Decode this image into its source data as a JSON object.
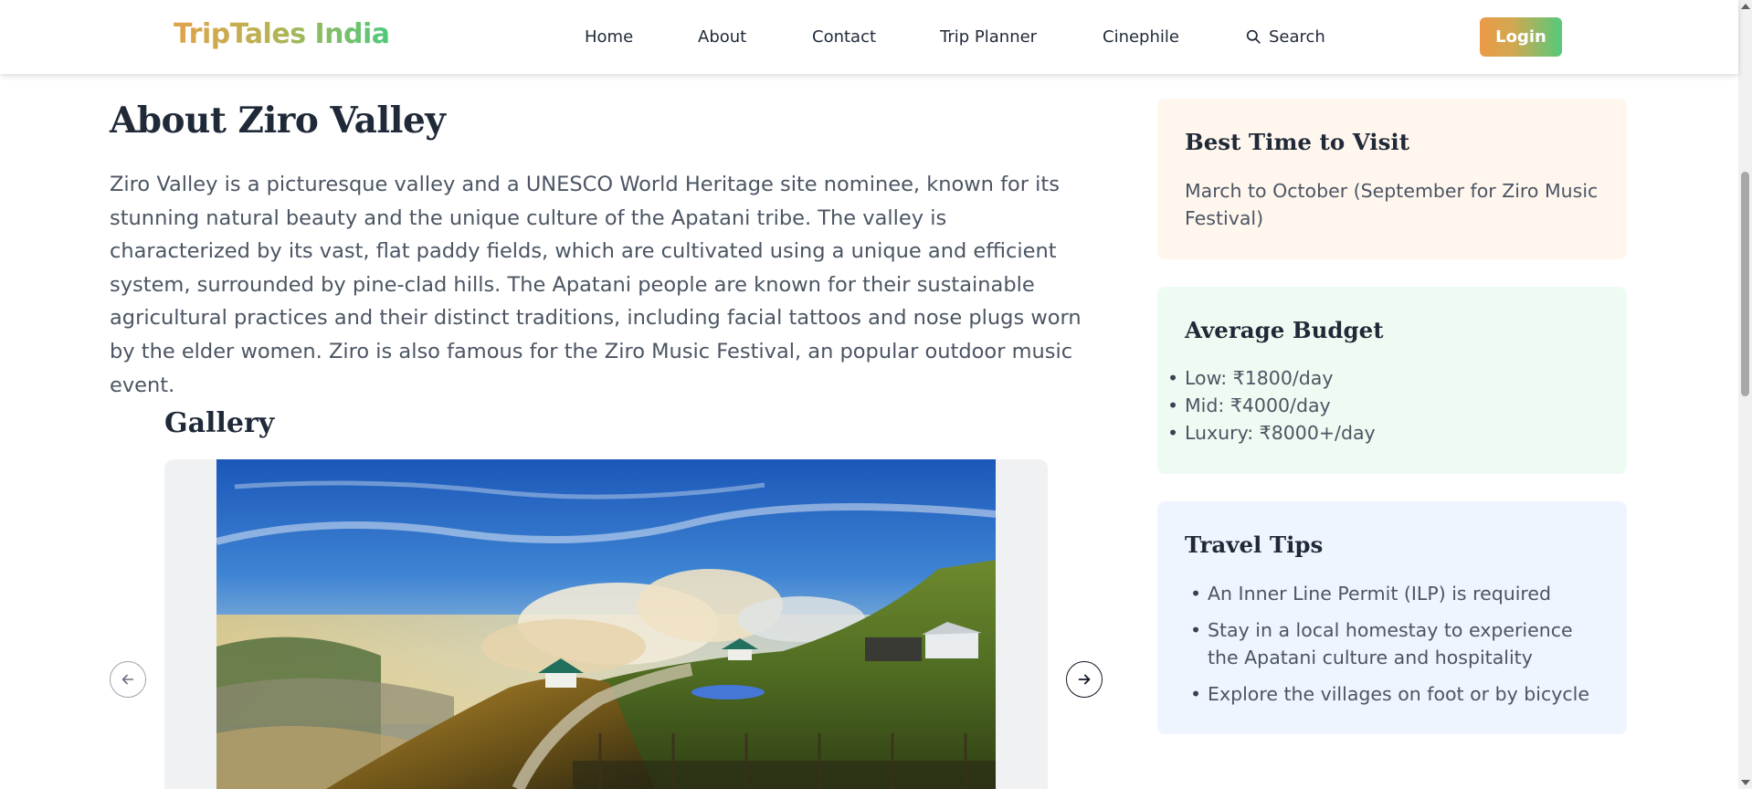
{
  "header": {
    "logo": "TripTales India",
    "nav": [
      {
        "label": "Home"
      },
      {
        "label": "About"
      },
      {
        "label": "Contact"
      },
      {
        "label": "Trip Planner"
      },
      {
        "label": "Cinephile"
      }
    ],
    "search": {
      "label": "Search",
      "icon": "search-icon"
    },
    "login_label": "Login",
    "login_colors": [
      "#ec9a45",
      "#55c97a"
    ]
  },
  "main": {
    "title": "About Ziro Valley",
    "intro": "Ziro Valley is a picturesque valley and a UNESCO World Heritage site nominee, known for its stunning natural beauty and the unique culture of the Apatani tribe. The valley is characterized by its vast, flat paddy fields, which are cultivated using a unique and efficient system, surrounded by pine-clad hills. The Apatani people are known for their sustainable agricultural practices and their distinct traditions, including facial tattoos and nose plugs worn by the elder women. Ziro is also famous for the Ziro Music Festival, an popular outdoor music event.",
    "gallery": {
      "title": "Gallery",
      "prev_icon": "arrow-left-icon",
      "next_icon": "arrow-right-icon"
    }
  },
  "sidebar": {
    "best_time": {
      "title": "Best Time to Visit",
      "text": "March to October (September for Ziro Music Festival)",
      "bg": "#fff6ee"
    },
    "budget": {
      "title": "Average Budget",
      "items": [
        "Low: ₹1800/day",
        "Mid: ₹4000/day",
        "Luxury: ₹8000+/day"
      ],
      "bg": "#eefbf2"
    },
    "tips": {
      "title": "Travel Tips",
      "items": [
        "An Inner Line Permit (ILP) is required",
        "Stay in a local homestay to experience the Apatani culture and hospitality",
        "Explore the villages on foot or by bicycle"
      ],
      "bg": "#eff5ff"
    }
  }
}
